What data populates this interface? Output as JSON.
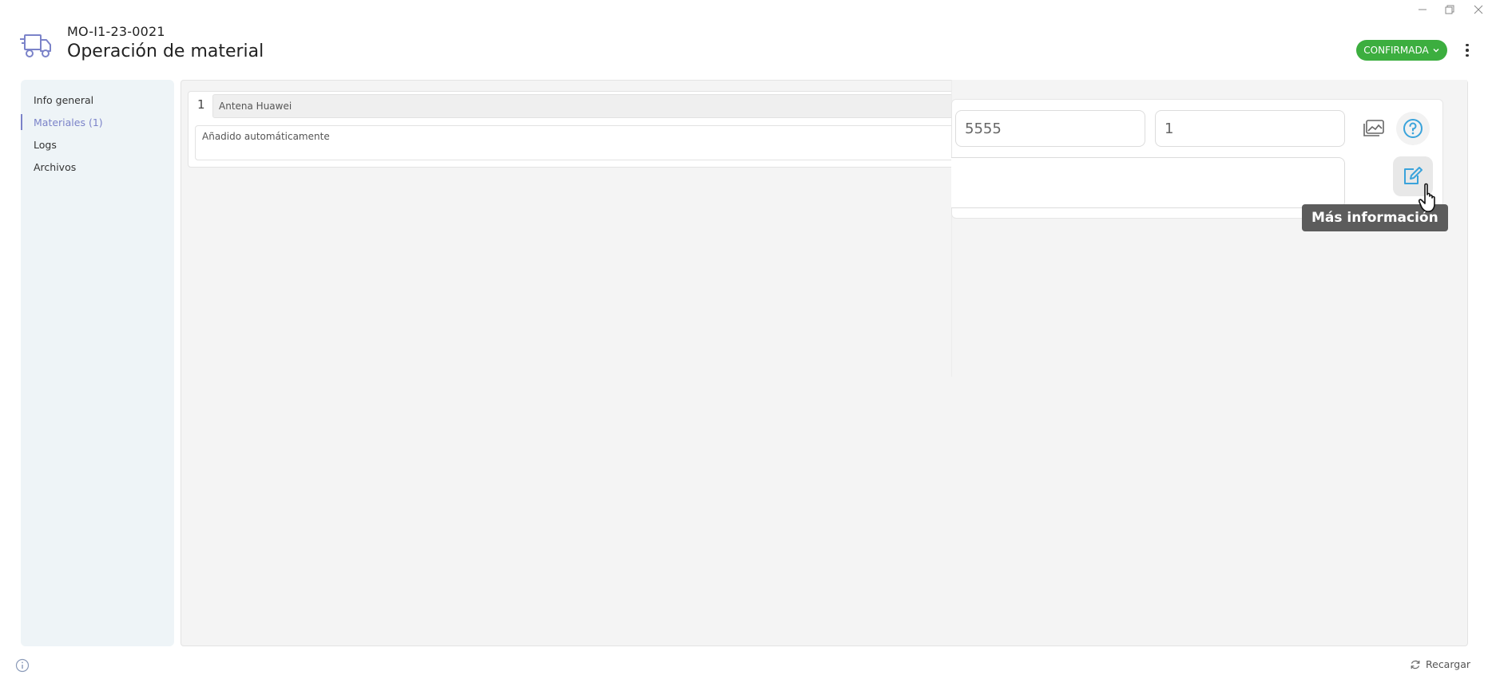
{
  "window": {
    "minimize_icon": "minimize-icon",
    "restore_icon": "restore-icon",
    "close_icon": "close-icon"
  },
  "header": {
    "icon": "truck-icon",
    "code": "MO-I1-23-0021",
    "title": "Operación de material",
    "status": "CONFIRMADA",
    "menu_icon": "kebab-menu-icon"
  },
  "sidebar": {
    "items": [
      {
        "label": "Info general",
        "active": false
      },
      {
        "label": "Materiales (1)",
        "active": true
      },
      {
        "label": "Logs",
        "active": false
      },
      {
        "label": "Archivos",
        "active": false
      }
    ]
  },
  "material_row": {
    "index": "1",
    "name": "Antena Huawei",
    "note": "Añadido automáticamente"
  },
  "zoom": {
    "code_value": "5555",
    "quantity_value": "1",
    "tooltip": "Más información"
  },
  "footer": {
    "reload_label": "Recargar"
  },
  "colors": {
    "status_green": "#3cae3f",
    "accent": "#7b83c9",
    "icon_blue": "#3aa3db"
  }
}
